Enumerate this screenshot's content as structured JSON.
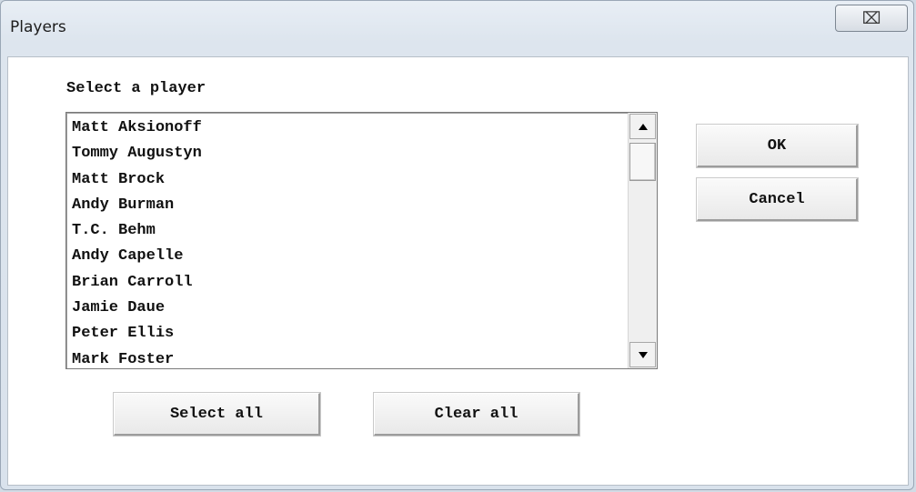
{
  "window": {
    "title": "Players",
    "close_glyph": "⌧"
  },
  "dialog": {
    "prompt": "Select a player",
    "players": [
      "Matt Aksionoff",
      "Tommy Augustyn",
      "Matt Brock",
      "Andy Burman",
      "T.C. Behm",
      "Andy Capelle",
      "Brian Carroll",
      "Jamie Daue",
      "Peter Ellis",
      "Mark Foster"
    ],
    "buttons": {
      "ok": "OK",
      "cancel": "Cancel",
      "select_all": "Select all",
      "clear_all": "Clear all"
    }
  }
}
